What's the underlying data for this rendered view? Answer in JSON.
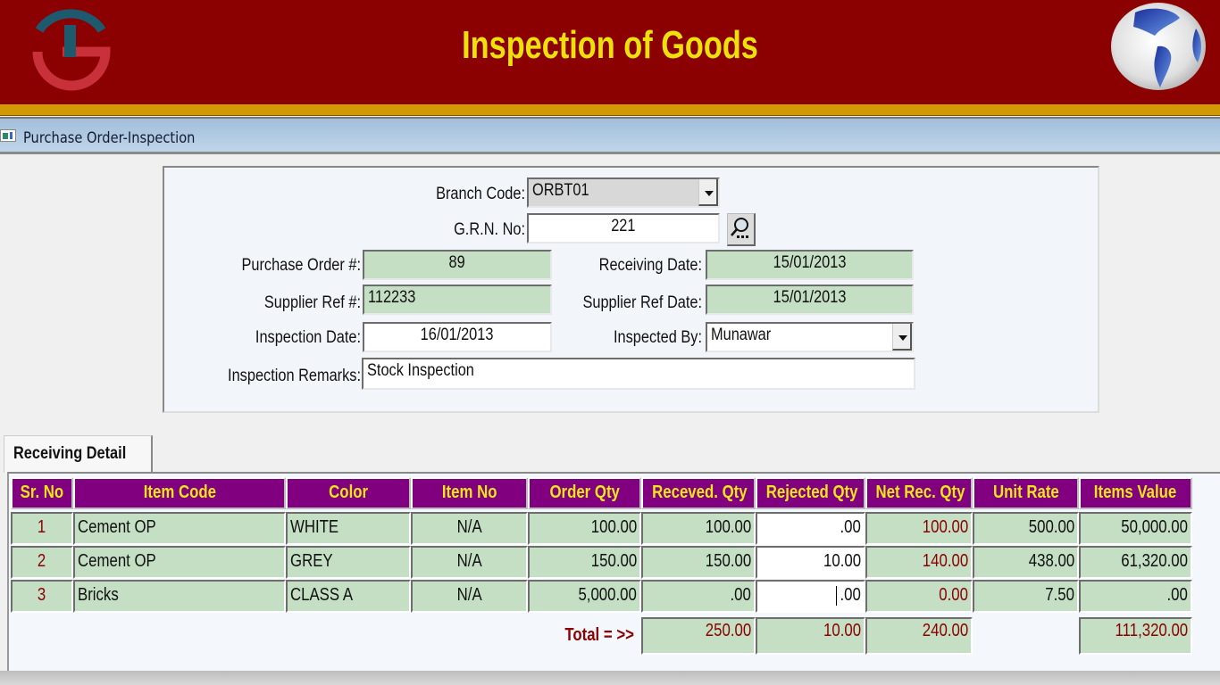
{
  "banner": {
    "title": "Inspection of Goods",
    "colors": {
      "background": "#8b0000",
      "title": "#ece10a",
      "strip": "#d19a04"
    },
    "logo_icon": "ts-logo-icon",
    "globe_icon": "globe-icon"
  },
  "window": {
    "title": "Purchase Order-Inspection",
    "icon": "form-window-icon"
  },
  "form": {
    "branch_code": {
      "label": "Branch Code:",
      "value": "ORBT01"
    },
    "grn_no": {
      "label": "G.R.N. No:",
      "value": "221"
    },
    "purchase_order": {
      "label": "Purchase Order #:",
      "value": "89"
    },
    "receiving_date": {
      "label": "Receiving Date:",
      "value": "15/01/2013"
    },
    "supplier_ref": {
      "label": "Supplier Ref #:",
      "value": "112233"
    },
    "supplier_ref_date": {
      "label": "Supplier Ref Date:",
      "value": "15/01/2013"
    },
    "inspection_date": {
      "label": "Inspection Date:",
      "value": "16/01/2013"
    },
    "inspected_by": {
      "label": "Inspected By:",
      "value": "Munawar"
    },
    "inspection_remarks": {
      "label": "Inspection Remarks:",
      "value": "Stock Inspection"
    }
  },
  "tabs": [
    {
      "label": "Receiving Detail",
      "active": true
    }
  ],
  "grid": {
    "colors": {
      "header_bg": "#800080",
      "header_text": "#f3e51b",
      "cell_bg": "#c4dfc4",
      "emphasis": "#8b0000"
    },
    "columns": [
      "Sr. No",
      "Item Code",
      "Color",
      "Item No",
      "Order Qty",
      "Receved. Qty",
      "Rejected Qty",
      "Net Rec. Qty",
      "Unit Rate",
      "Items Value"
    ],
    "rows": [
      {
        "sr": "1",
        "item_code": "Cement OP",
        "color": "WHITE",
        "item_no": "N/A",
        "order_qty": "100.00",
        "received_qty": "100.00",
        "rejected_qty": ".00",
        "net_rec_qty": "100.00",
        "unit_rate": "500.00",
        "items_value": "50,000.00"
      },
      {
        "sr": "2",
        "item_code": "Cement OP",
        "color": "GREY",
        "item_no": "N/A",
        "order_qty": "150.00",
        "received_qty": "150.00",
        "rejected_qty": "10.00",
        "net_rec_qty": "140.00",
        "unit_rate": "438.00",
        "items_value": "61,320.00"
      },
      {
        "sr": "3",
        "item_code": "Bricks",
        "color": "CLASS A",
        "item_no": "N/A",
        "order_qty": "5,000.00",
        "received_qty": ".00",
        "rejected_qty": ".00",
        "net_rec_qty": "0.00",
        "unit_rate": "7.50",
        "items_value": ".00"
      }
    ],
    "totals": {
      "label": "Total = >>",
      "received_qty": "250.00",
      "rejected_qty": "10.00",
      "net_rec_qty": "240.00",
      "items_value": "111,320.00"
    }
  }
}
